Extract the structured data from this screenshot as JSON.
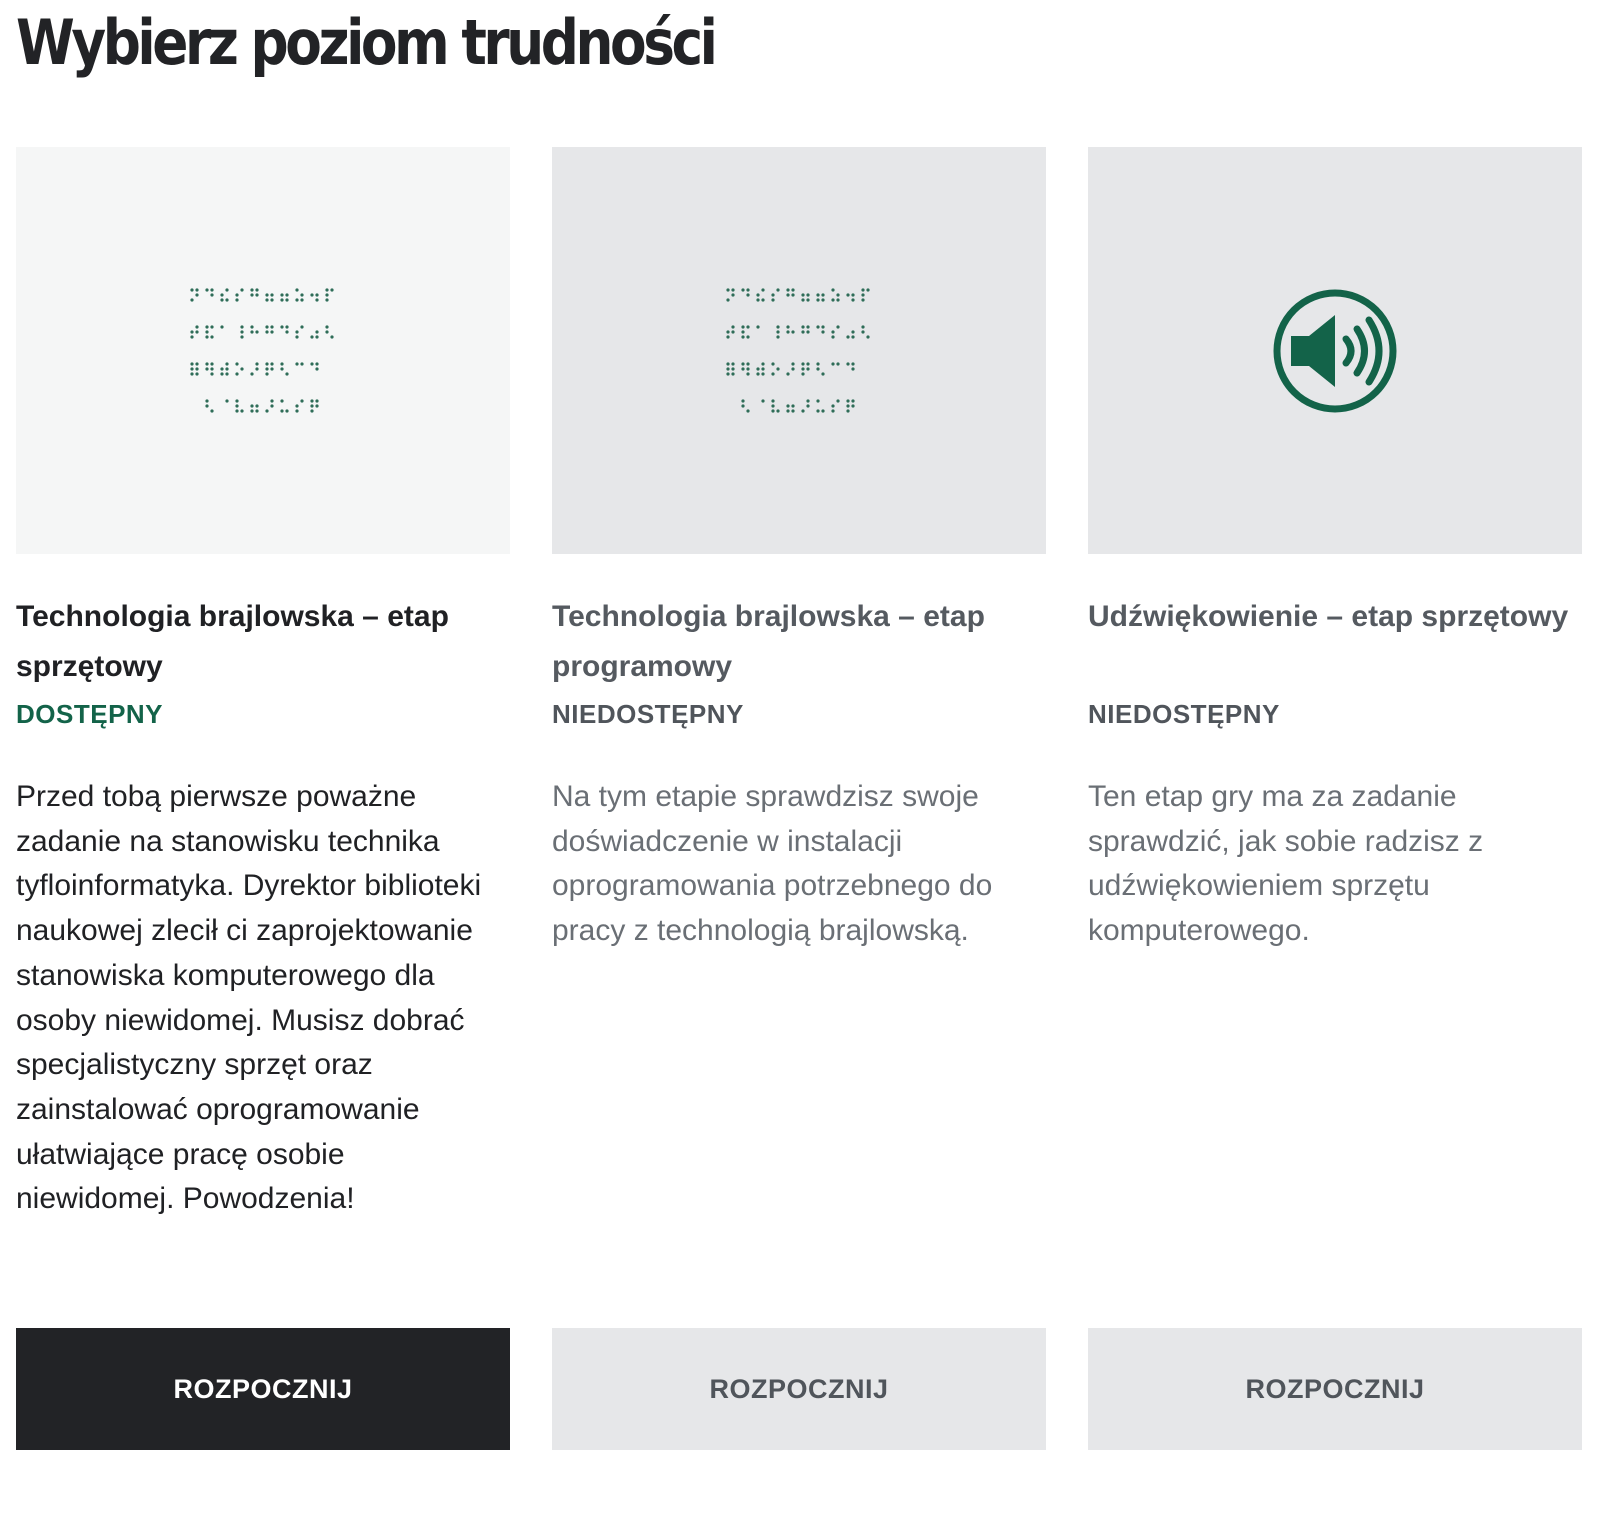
{
  "page": {
    "title": "Wybierz poziom trudności"
  },
  "colors": {
    "accent_green": "#136349",
    "dark_button": "#222326",
    "disabled_bg": "#e6e7e9",
    "light_bg": "#f5f6f6"
  },
  "cards": [
    {
      "image_icon": "braille-text-icon",
      "title": "Technologia brajlowska – etap sprzętowy",
      "status": "DOSTĘPNY",
      "description": "Przed tobą pierwsze poważne zadanie na stanowisku technika tyfloinformatyka. Dyrektor biblioteki naukowej zlecił ci zaprojektowanie stanowiska komputerowego dla osoby niewidomej. Musisz dobrać specjalistyczny sprzęt oraz zainstalować oprogramowanie ułatwiające pracę osobie niewidomej. Powodzenia!",
      "button_label": "ROZPOCZNIJ",
      "available": true
    },
    {
      "image_icon": "braille-text-icon",
      "title": "Technologia brajlowska – etap programowy",
      "status": "NIEDOSTĘPNY",
      "description": "Na tym etapie sprawdzisz swoje doświadczenie w instalacji oprogramowania potrzebnego do pracy z technologią brajlowską.",
      "button_label": "ROZPOCZNIJ",
      "available": false
    },
    {
      "image_icon": "speaker-volume-icon",
      "title": "Udźwiękowienie – etap sprzętowy",
      "status": "NIEDOSTĘPNY",
      "description": "Ten etap gry ma za zadanie sprawdzić, jak sobie radzisz z udźwiękowieniem sprzętu komputerowego.",
      "button_label": "ROZPOCZNIJ",
      "available": false
    }
  ]
}
